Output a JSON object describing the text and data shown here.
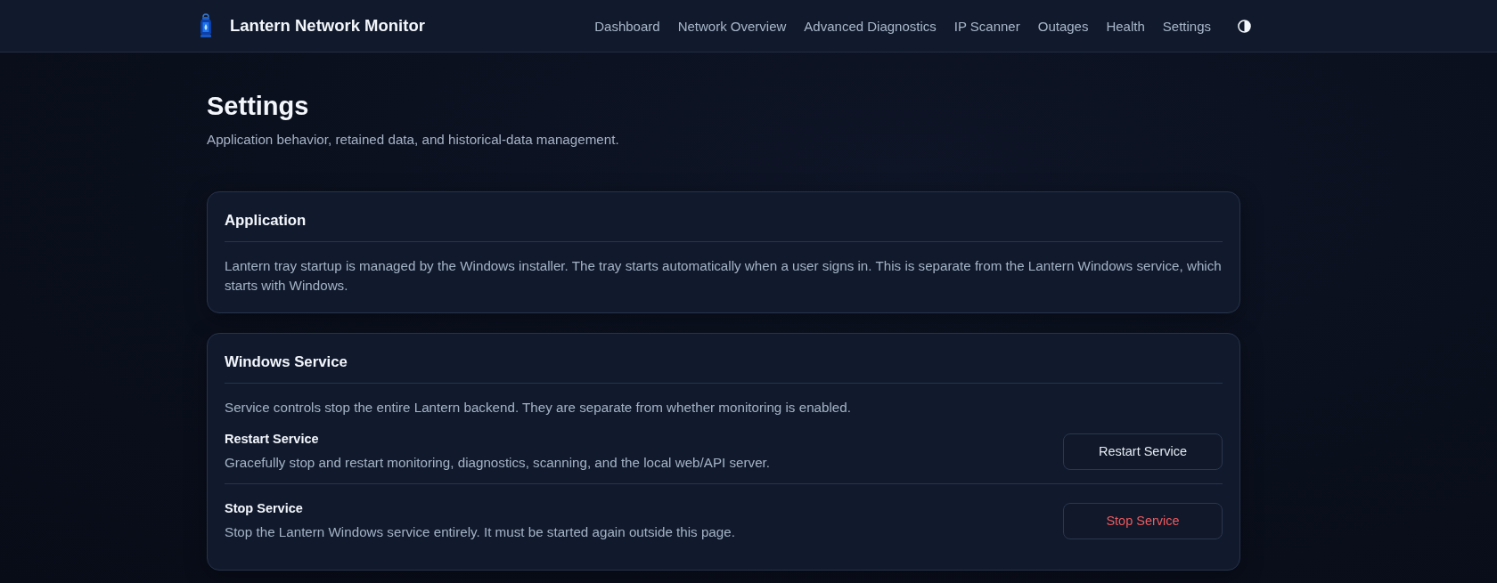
{
  "header": {
    "title": "Lantern Network Monitor",
    "nav": [
      "Dashboard",
      "Network Overview",
      "Advanced Diagnostics",
      "IP Scanner",
      "Outages",
      "Health",
      "Settings"
    ]
  },
  "page": {
    "title": "Settings",
    "subtitle": "Application behavior, retained data, and historical-data management."
  },
  "sections": [
    {
      "title": "Application",
      "description": "Lantern tray startup is managed by the Windows installer. The tray starts automatically when a user signs in. This is separate from the Lantern Windows service, which starts with Windows."
    },
    {
      "title": "Windows Service",
      "description": "Service controls stop the entire Lantern backend. They are separate from whether monitoring is enabled.",
      "actions": [
        {
          "title": "Restart Service",
          "description": "Gracefully stop and restart monitoring, diagnostics, scanning, and the local web/API server.",
          "button": "Restart Service",
          "kind": "default"
        },
        {
          "title": "Stop Service",
          "description": "Stop the Lantern Windows service entirely. It must be started again outside this page.",
          "button": "Stop Service",
          "kind": "danger"
        }
      ]
    }
  ]
}
